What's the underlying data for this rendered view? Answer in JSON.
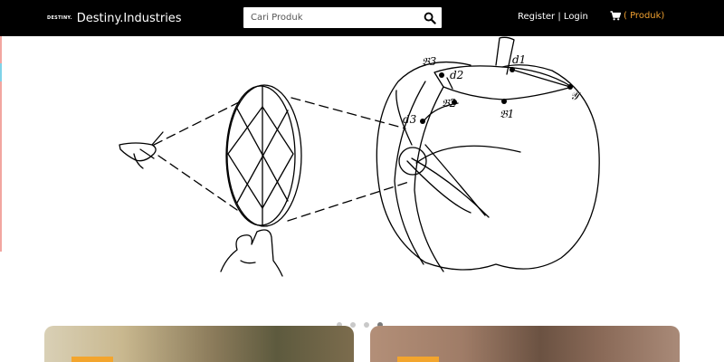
{
  "navbar": {
    "brand_logo": "DESTINY.",
    "brand_name": "Destiny.Industries",
    "search_placeholder": "Cari Produk",
    "register_label": "Register",
    "separator": "|",
    "login_label": "Login",
    "cart_label": "( Produk)"
  },
  "hero": {
    "slide_count": 4,
    "active_slide": 4,
    "illustration_labels": [
      "𝔅3",
      "d2",
      "d1",
      "𝔅2",
      "𝔅1",
      "d3",
      "𝒴"
    ]
  },
  "colors": {
    "navbar_bg": "#000000",
    "accent": "#f0a030",
    "tag": "#f3a52d",
    "edge_strip": [
      "#f2a6a0",
      "#7fd3e8",
      "#f2a6a0",
      "#f2a6a0"
    ]
  },
  "icons": {
    "search": "search-icon",
    "cart": "cart-icon"
  }
}
